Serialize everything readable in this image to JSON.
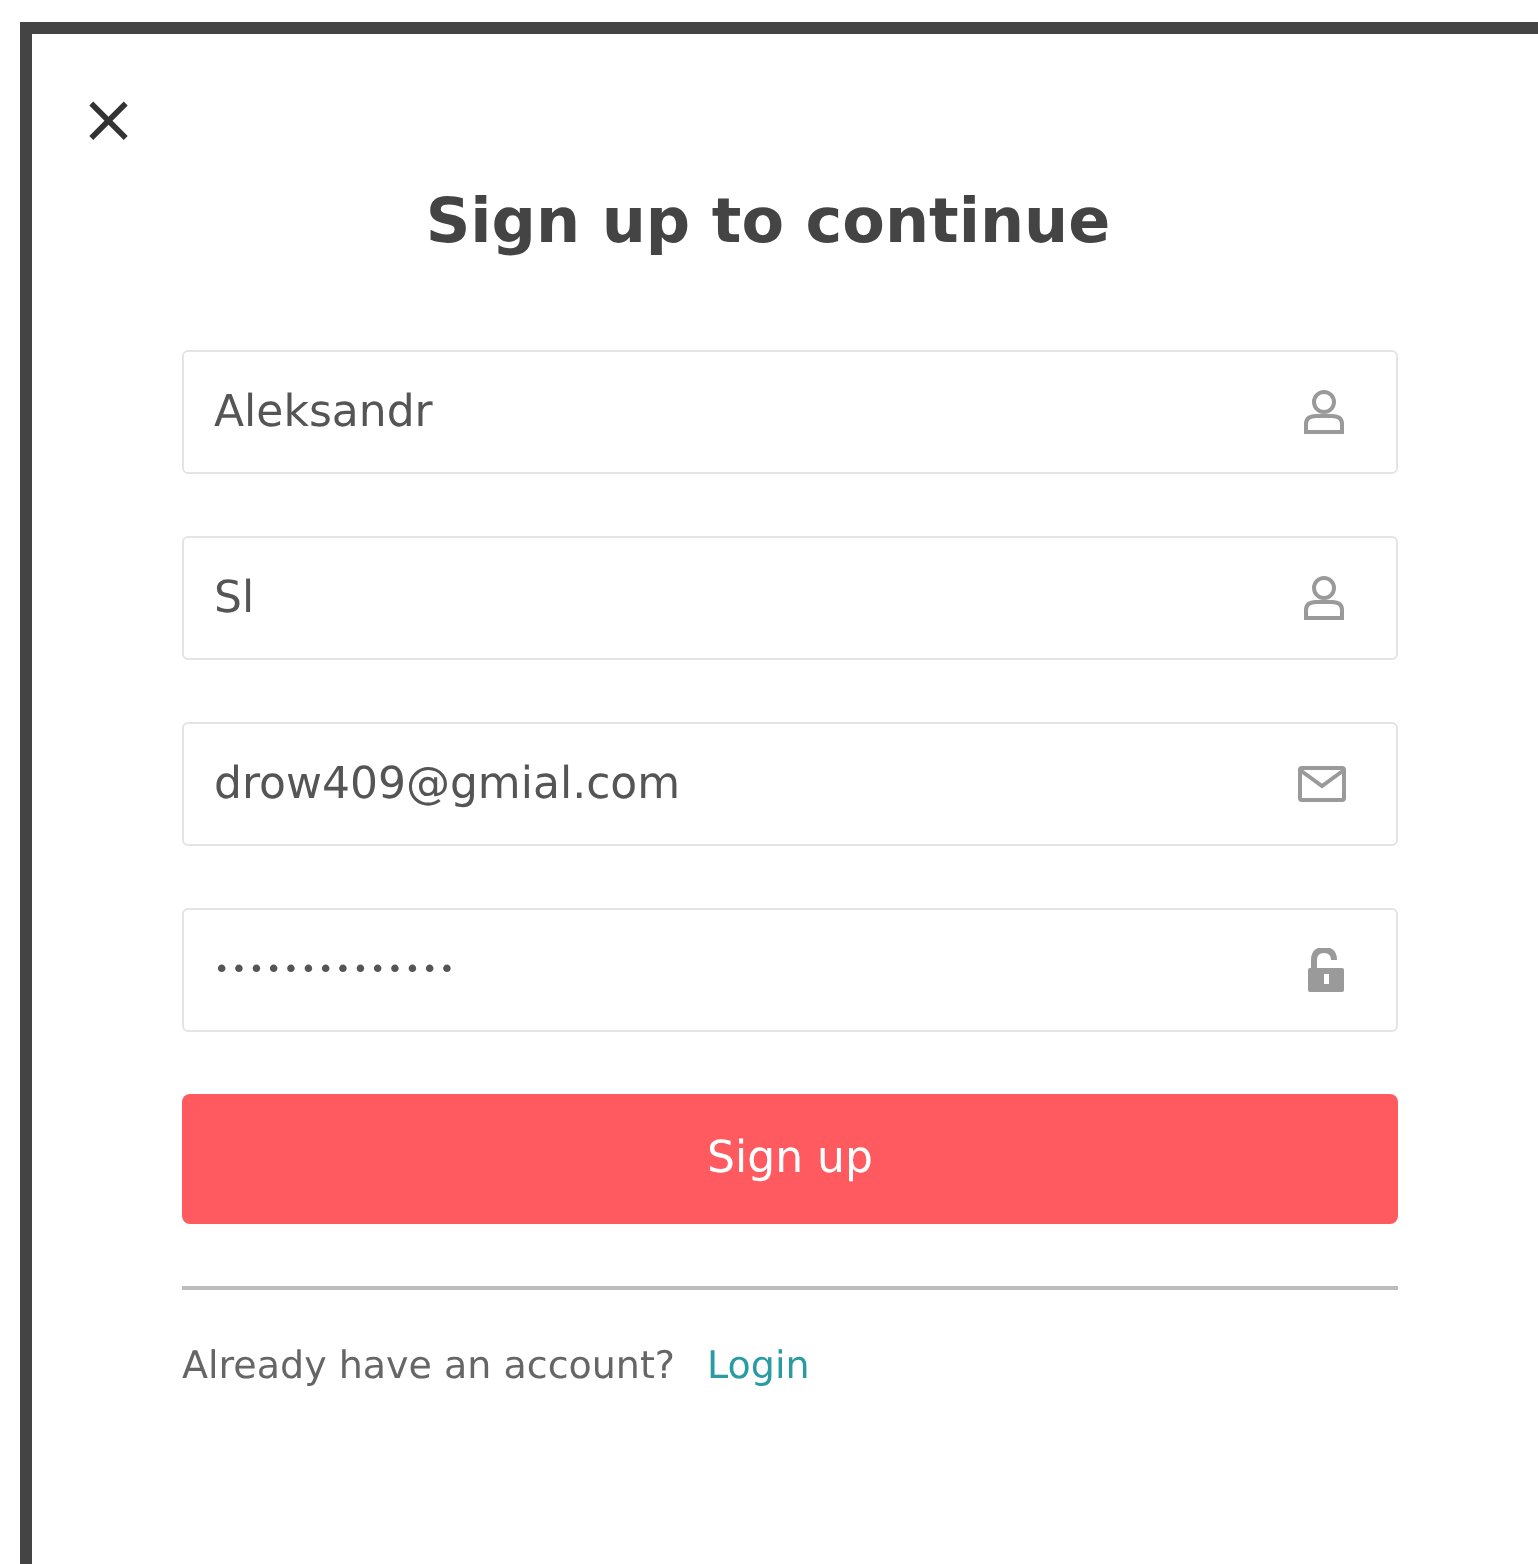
{
  "dialog": {
    "close": "×",
    "title": "Sign up to continue"
  },
  "fields": [
    {
      "value": "Aleksandr",
      "kind": "person"
    },
    {
      "value": "Sl",
      "kind": "person"
    },
    {
      "value": "drow409@gmial.com",
      "kind": "mail"
    },
    {
      "value": "••••••••••••••",
      "kind": "lock",
      "masked": true
    }
  ],
  "submit": "Sign up",
  "footer": {
    "text": "Already have an account?",
    "link": "Login"
  }
}
